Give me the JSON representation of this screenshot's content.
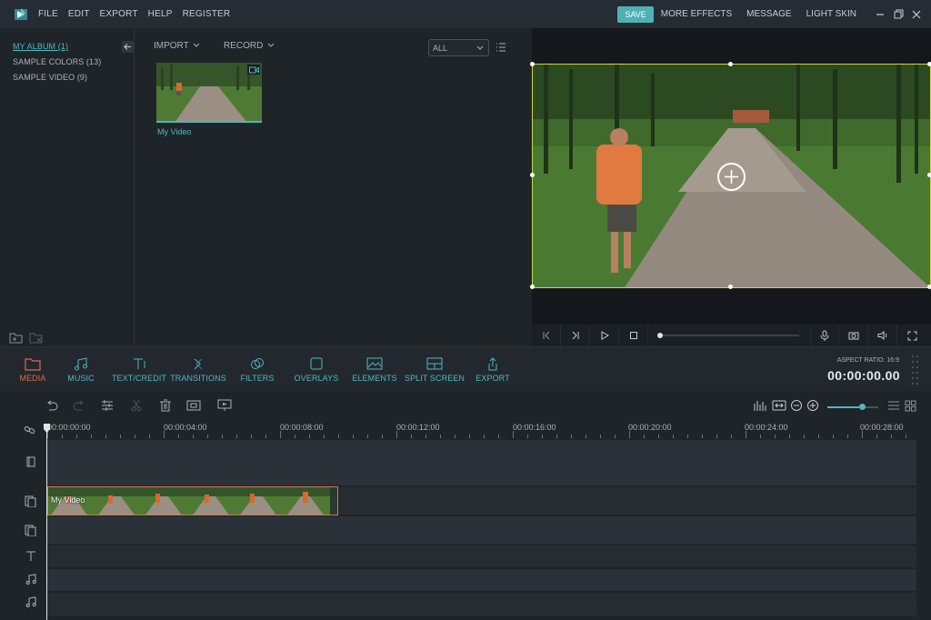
{
  "titlebar": {
    "menus": [
      "FILE",
      "EDIT",
      "EXPORT",
      "HELP",
      "REGISTER"
    ],
    "save": "SAVE",
    "more_effects": "MORE EFFECTS",
    "message": "MESSAGE",
    "light_skin": "LIGHT SKIN"
  },
  "sidebar": {
    "albums": [
      "MY ALBUM (1)",
      "SAMPLE COLORS (13)",
      "SAMPLE VIDEO (9)"
    ]
  },
  "library": {
    "import": "IMPORT",
    "record": "RECORD",
    "filter": "ALL",
    "items": [
      {
        "label": "My Video"
      }
    ]
  },
  "tools": [
    "MEDIA",
    "MUSIC",
    "TEXT/CREDIT",
    "TRANSITIONS",
    "FILTERS",
    "OVERLAYS",
    "ELEMENTS",
    "SPLIT SCREEN",
    "EXPORT"
  ],
  "status": {
    "aspect_ratio": "ASPECT RATIO: 16:9",
    "timecode": "00:00:00.00",
    "playback_progress": 0
  },
  "ruler": [
    "00:00:00:00",
    "00:00:04:00",
    "00:00:08:00",
    "00:00:12:00",
    "00:00:16:00",
    "00:00:20:00",
    "00:00:24:00",
    "00:00:28:00"
  ],
  "timeline": {
    "clip_label": "My Video"
  },
  "colors": {
    "accent": "#4fb8c0",
    "active_tab": "#e06a4e",
    "save": "#4fb0b7",
    "frame_border": "#c9d64a"
  }
}
